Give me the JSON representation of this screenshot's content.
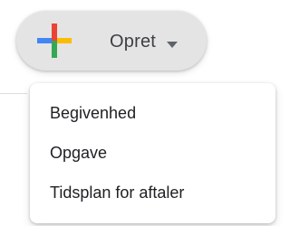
{
  "create": {
    "icon": "plus-icon",
    "label": "Opret",
    "caret_icon": "caret-down-icon"
  },
  "menu": {
    "items": [
      {
        "label": "Begivenhed"
      },
      {
        "label": "Opgave"
      },
      {
        "label": "Tidsplan for aftaler"
      }
    ]
  },
  "colors": {
    "plus_blue": "#4285F4",
    "plus_red": "#EA4335",
    "plus_yellow": "#FBBC04",
    "plus_green": "#34A853",
    "button_bg": "#e4e4e4",
    "text": "#202124"
  }
}
